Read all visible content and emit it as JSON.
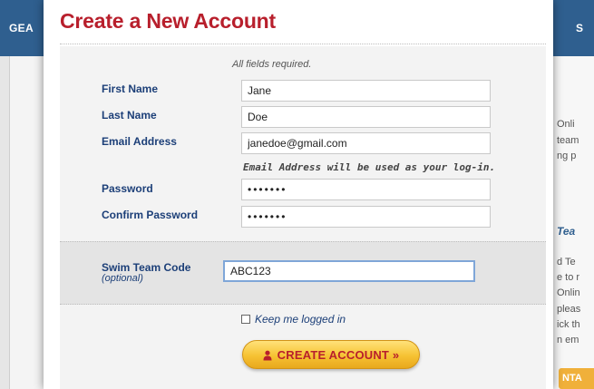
{
  "background": {
    "header_left": "GEA",
    "header_right": "S",
    "right_fragments": [
      "Onli",
      "team",
      "ng p"
    ],
    "right_heading": "Tea",
    "right_lines": [
      "d Te",
      "e to r",
      "Onlin",
      "pleas",
      "ick th",
      "n em"
    ],
    "right_button": "NTA"
  },
  "modal": {
    "title": "Create a New Account",
    "fields_required_note": "All fields required.",
    "fields": {
      "first_name": {
        "label": "First Name",
        "value": "Jane"
      },
      "last_name": {
        "label": "Last Name",
        "value": "Doe"
      },
      "email": {
        "label": "Email Address",
        "value": "janedoe@gmail.com"
      },
      "email_hint": "Email Address will be used as your log-in.",
      "password": {
        "label": "Password",
        "value": "•••••••"
      },
      "confirm_password": {
        "label": "Confirm Password",
        "value": "•••••••"
      }
    },
    "swim_team_code": {
      "label": "Swim Team Code",
      "sublabel": "(optional)",
      "value": "ABC123"
    },
    "keep_logged_in": {
      "label": "Keep me logged in",
      "checked": false
    },
    "create_button": {
      "label": "CREATE ACCOUNT »",
      "icon": "user-icon"
    }
  },
  "colors": {
    "title_red": "#b81f2c",
    "label_blue": "#1c3f78",
    "button_yellow": "#f6c233"
  }
}
